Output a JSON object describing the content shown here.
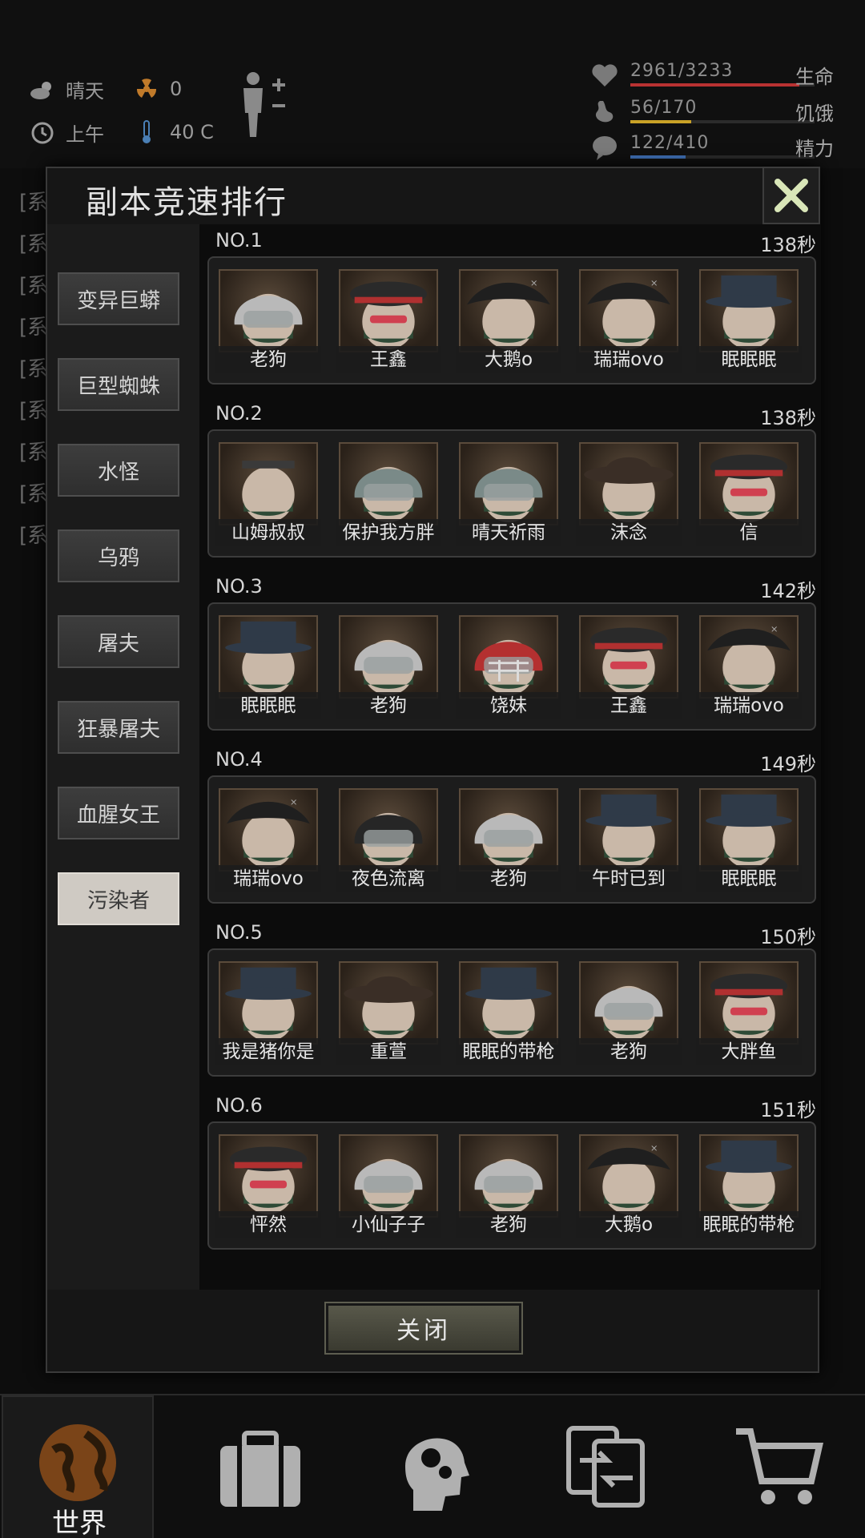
{
  "hud": {
    "weather": "晴天",
    "radiation": "0",
    "time_of_day": "上午",
    "temperature": "40 C",
    "health": {
      "label": "生命",
      "value": "2961/3233",
      "fraction": 0.916,
      "color": "#b83232"
    },
    "hunger": {
      "label": "饥饿",
      "value": "56/170",
      "fraction": 0.329,
      "color": "#c9a227"
    },
    "energy": {
      "label": "精力",
      "value": "122/410",
      "fraction": 0.298,
      "color": "#3f6fb5"
    }
  },
  "chat_tag": "[系",
  "dialog": {
    "title": "副本竞速排行",
    "close_label": "关闭"
  },
  "categories": [
    {
      "label": "变异巨蟒",
      "active": false
    },
    {
      "label": "巨型蜘蛛",
      "active": false
    },
    {
      "label": "水怪",
      "active": false
    },
    {
      "label": "乌鸦",
      "active": false
    },
    {
      "label": "屠夫",
      "active": false
    },
    {
      "label": "狂暴屠夫",
      "active": false
    },
    {
      "label": "血腥女王",
      "active": false
    },
    {
      "label": "污染者",
      "active": true
    }
  ],
  "rankings": [
    {
      "rank": "NO.1",
      "time": "138秒",
      "members": [
        {
          "name": "老狗",
          "gear": "police-helmet"
        },
        {
          "name": "王鑫",
          "gear": "officer-cap"
        },
        {
          "name": "大鹅o",
          "gear": "pirate-hat"
        },
        {
          "name": "瑞瑞ovo",
          "gear": "pirate-hat"
        },
        {
          "name": "眠眠眠",
          "gear": "top-hat"
        }
      ]
    },
    {
      "rank": "NO.2",
      "time": "138秒",
      "members": [
        {
          "name": "山姆叔叔",
          "gear": "maid-band"
        },
        {
          "name": "保护我方胖",
          "gear": "riot-helmet"
        },
        {
          "name": "晴天祈雨",
          "gear": "riot-helmet"
        },
        {
          "name": "沫念",
          "gear": "wide-hat"
        },
        {
          "name": "信",
          "gear": "officer-cap"
        }
      ]
    },
    {
      "rank": "NO.3",
      "time": "142秒",
      "members": [
        {
          "name": "眠眠眠",
          "gear": "top-hat"
        },
        {
          "name": "老狗",
          "gear": "police-helmet"
        },
        {
          "name": "饶妹",
          "gear": "football-helmet"
        },
        {
          "name": "王鑫",
          "gear": "officer-cap"
        },
        {
          "name": "瑞瑞ovo",
          "gear": "pirate-hat"
        }
      ]
    },
    {
      "rank": "NO.4",
      "time": "149秒",
      "members": [
        {
          "name": "瑞瑞ovo",
          "gear": "pirate-hat"
        },
        {
          "name": "夜色流离",
          "gear": "moto-helmet"
        },
        {
          "name": "老狗",
          "gear": "police-helmet"
        },
        {
          "name": "午时已到",
          "gear": "top-hat"
        },
        {
          "name": "眠眠眠",
          "gear": "top-hat"
        }
      ]
    },
    {
      "rank": "NO.5",
      "time": "150秒",
      "members": [
        {
          "name": "我是猪你是",
          "gear": "top-hat"
        },
        {
          "name": "重萱",
          "gear": "wide-hat"
        },
        {
          "name": "眠眠的带枪",
          "gear": "top-hat"
        },
        {
          "name": "老狗",
          "gear": "police-helmet"
        },
        {
          "name": "大胖鱼",
          "gear": "officer-cap"
        }
      ]
    },
    {
      "rank": "NO.6",
      "time": "151秒",
      "members": [
        {
          "name": "怦然",
          "gear": "officer-cap"
        },
        {
          "name": "小仙子子",
          "gear": "police-helmet"
        },
        {
          "name": "老狗",
          "gear": "police-helmet"
        },
        {
          "name": "大鹅o",
          "gear": "pirate-hat"
        },
        {
          "name": "眠眠的带枪",
          "gear": "top-hat"
        }
      ]
    }
  ],
  "gear_colors": {
    "police-helmet": "#b9b9b9",
    "officer-cap": "#2a2a2a",
    "pirate-hat": "#1f1f1f",
    "top-hat": "#2f3a48",
    "maid-band": "#3a3a3a",
    "riot-helmet": "#7a8a88",
    "wide-hat": "#3a2e26",
    "football-helmet": "#b43030",
    "moto-helmet": "#262626"
  },
  "bottom_nav": [
    {
      "label": "世界",
      "icon": "globe-icon",
      "active": true
    },
    {
      "label": "",
      "icon": "briefcase-icon",
      "active": false
    },
    {
      "label": "",
      "icon": "head-gears-icon",
      "active": false
    },
    {
      "label": "",
      "icon": "exchange-icon",
      "active": false
    },
    {
      "label": "",
      "icon": "cart-icon",
      "active": false
    }
  ]
}
